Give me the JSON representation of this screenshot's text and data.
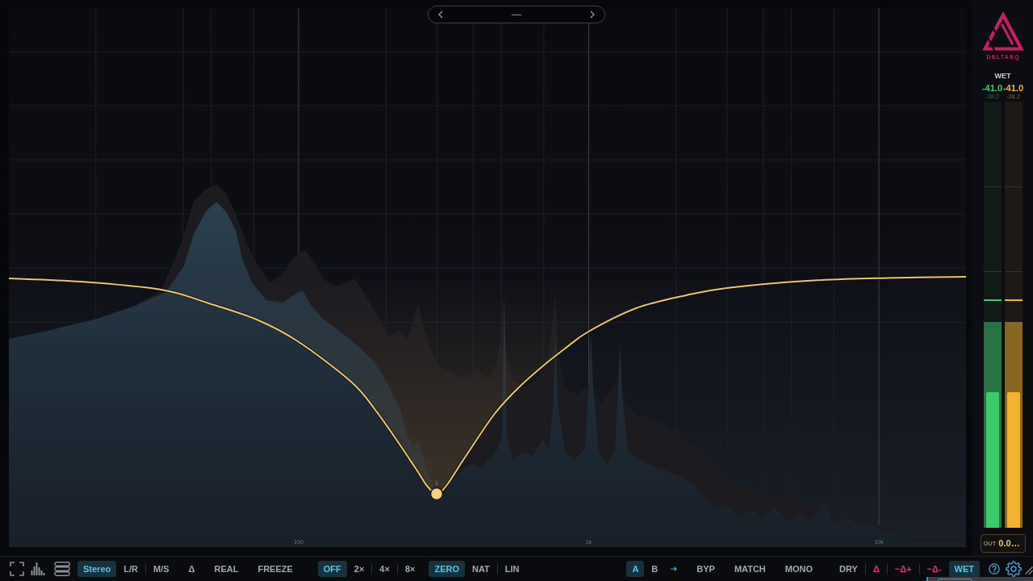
{
  "preset_bar": {
    "name": "—"
  },
  "plot": {
    "frequency_labels": [
      "100",
      "1k",
      "10k"
    ],
    "bands": [
      {
        "number": "1"
      }
    ]
  },
  "side_panel": {
    "brand": "DELTAEQ",
    "meter_source": "WET",
    "meters": [
      {
        "reading": "-41.0",
        "peak_reading": "-28.2",
        "color": "#3ecb6a",
        "peak": {
          "level": 0.483
        },
        "rms": {
          "level": 0.318
        },
        "hold": {
          "level": 0.532
        }
      },
      {
        "reading": "-41.0",
        "peak_reading": "-28.2",
        "color": "#f2b330",
        "peak": {
          "level": 0.483
        },
        "rms": {
          "level": 0.318
        },
        "hold": {
          "level": 0.532
        }
      }
    ],
    "output": {
      "label": "OUT",
      "value": "0.0…"
    }
  },
  "toolbar": {
    "channel_modes": [
      {
        "label": "Stereo",
        "selected": true
      },
      {
        "label": "L/R",
        "selected": false
      },
      {
        "label": "M/S",
        "selected": false
      }
    ],
    "analyzer_toggles": [
      {
        "label": "Δ",
        "on": false
      },
      {
        "label": "REAL",
        "on": false
      },
      {
        "label": "FREEZE",
        "on": false
      }
    ],
    "oversampling": [
      {
        "label": "OFF",
        "selected": true
      },
      {
        "label": "2×",
        "selected": false
      },
      {
        "label": "4×",
        "selected": false
      },
      {
        "label": "8×",
        "selected": false
      }
    ],
    "phase_modes": [
      {
        "label": "ZERO",
        "selected": true
      },
      {
        "label": "NAT",
        "selected": false
      },
      {
        "label": "LIN",
        "selected": false
      }
    ],
    "ab_slots": [
      {
        "label": "A",
        "selected": true
      },
      {
        "label": "B",
        "selected": false
      }
    ],
    "compare_toggles": [
      {
        "label": "BYP",
        "on": false
      },
      {
        "label": "MATCH",
        "on": false
      },
      {
        "label": "MONO",
        "on": false
      }
    ],
    "listen_modes": [
      {
        "label": "DRY",
        "kind": "plain",
        "selected": false
      },
      {
        "label": "Δ",
        "kind": "delta",
        "selected": false
      },
      {
        "label": "~Δ+",
        "kind": "delta",
        "selected": false
      },
      {
        "label": "~Δ-",
        "kind": "delta",
        "selected": false
      },
      {
        "label": "WET",
        "kind": "plain",
        "selected": true
      }
    ]
  }
}
